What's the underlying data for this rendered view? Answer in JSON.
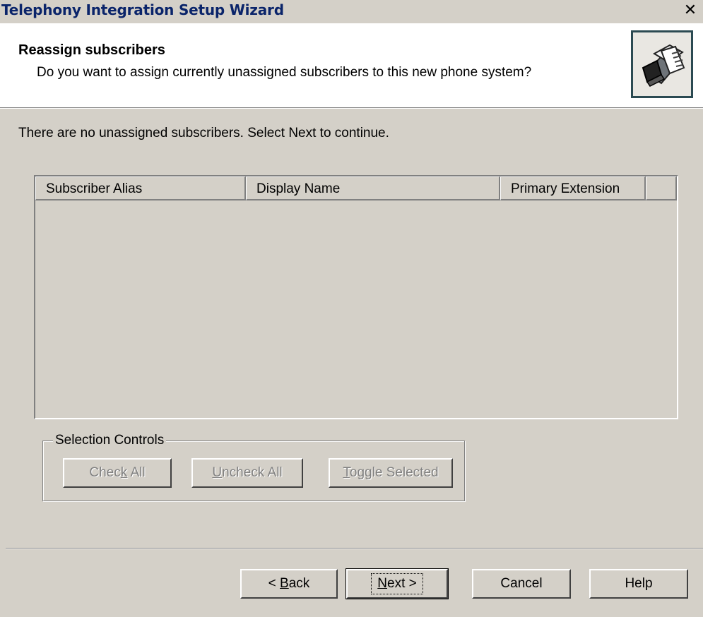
{
  "window": {
    "title": "Telephony Integration Setup Wizard",
    "close_glyph": "✕"
  },
  "header": {
    "title": "Reassign subscribers",
    "subtitle": "Do you want to assign currently unassigned subscribers to this new phone system?",
    "icon": "wizard-document-icon"
  },
  "info_text": "There are no unassigned subscribers.  Select Next to continue.",
  "table": {
    "columns": [
      "Subscriber Alias",
      "Display Name",
      "Primary Extension"
    ],
    "rows": []
  },
  "selection_controls": {
    "label": "Selection Controls",
    "buttons": {
      "check_all": {
        "pre": "Chec",
        "mnemonic": "k",
        "post": " All"
      },
      "uncheck_all": {
        "pre": "",
        "mnemonic": "U",
        "post": "ncheck All"
      },
      "toggle_selected": {
        "pre": "",
        "mnemonic": "T",
        "post": "oggle Selected"
      }
    }
  },
  "footer": {
    "back": {
      "pre": "< ",
      "mnemonic": "B",
      "post": "ack"
    },
    "next": {
      "pre": "",
      "mnemonic": "N",
      "post": "ext >"
    },
    "cancel": "Cancel",
    "help": "Help"
  },
  "colors": {
    "face": "#d4d0c8",
    "title_text": "#0a246a",
    "disabled_text": "#808080"
  }
}
